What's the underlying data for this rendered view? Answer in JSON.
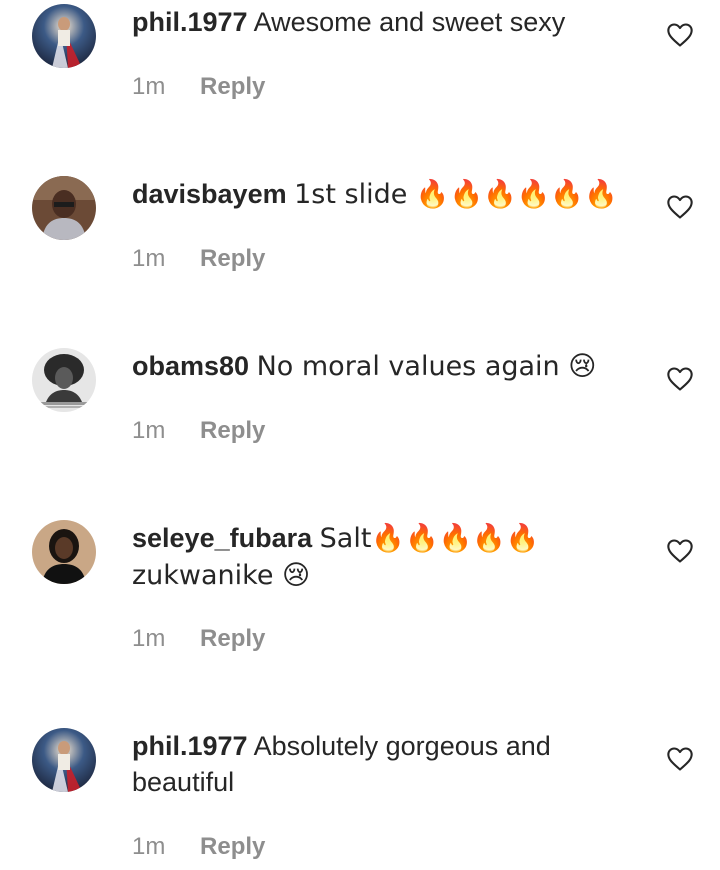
{
  "comments": [
    {
      "username": "phil.1977",
      "text": "Awesome and sweet sexy",
      "time": "1m",
      "reply_label": "Reply",
      "avatar_icon": "religious-portrait-avatar",
      "like_icon": "heart-outline-icon"
    },
    {
      "username": "davisbayem",
      "text": "1st slide 🔥🔥🔥🔥🔥🔥",
      "time": "1m",
      "reply_label": "Reply",
      "avatar_icon": "man-portrait-avatar",
      "like_icon": "heart-outline-icon"
    },
    {
      "username": "obams80",
      "text": "No moral values again 😢",
      "time": "1m",
      "reply_label": "Reply",
      "avatar_icon": "bw-portrait-avatar",
      "like_icon": "heart-outline-icon"
    },
    {
      "username": "seleye_fubara",
      "text": "Salt🔥🔥🔥🔥🔥 zukwanike 😢",
      "time": "1m",
      "reply_label": "Reply",
      "avatar_icon": "woman-portrait-avatar",
      "like_icon": "heart-outline-icon"
    },
    {
      "username": "phil.1977",
      "text": "Absolutely gorgeous and beautiful",
      "time": "1m",
      "reply_label": "Reply",
      "avatar_icon": "religious-portrait-avatar",
      "like_icon": "heart-outline-icon"
    }
  ],
  "colors": {
    "text": "#262626",
    "meta": "#8e8e8e",
    "background": "#ffffff"
  }
}
